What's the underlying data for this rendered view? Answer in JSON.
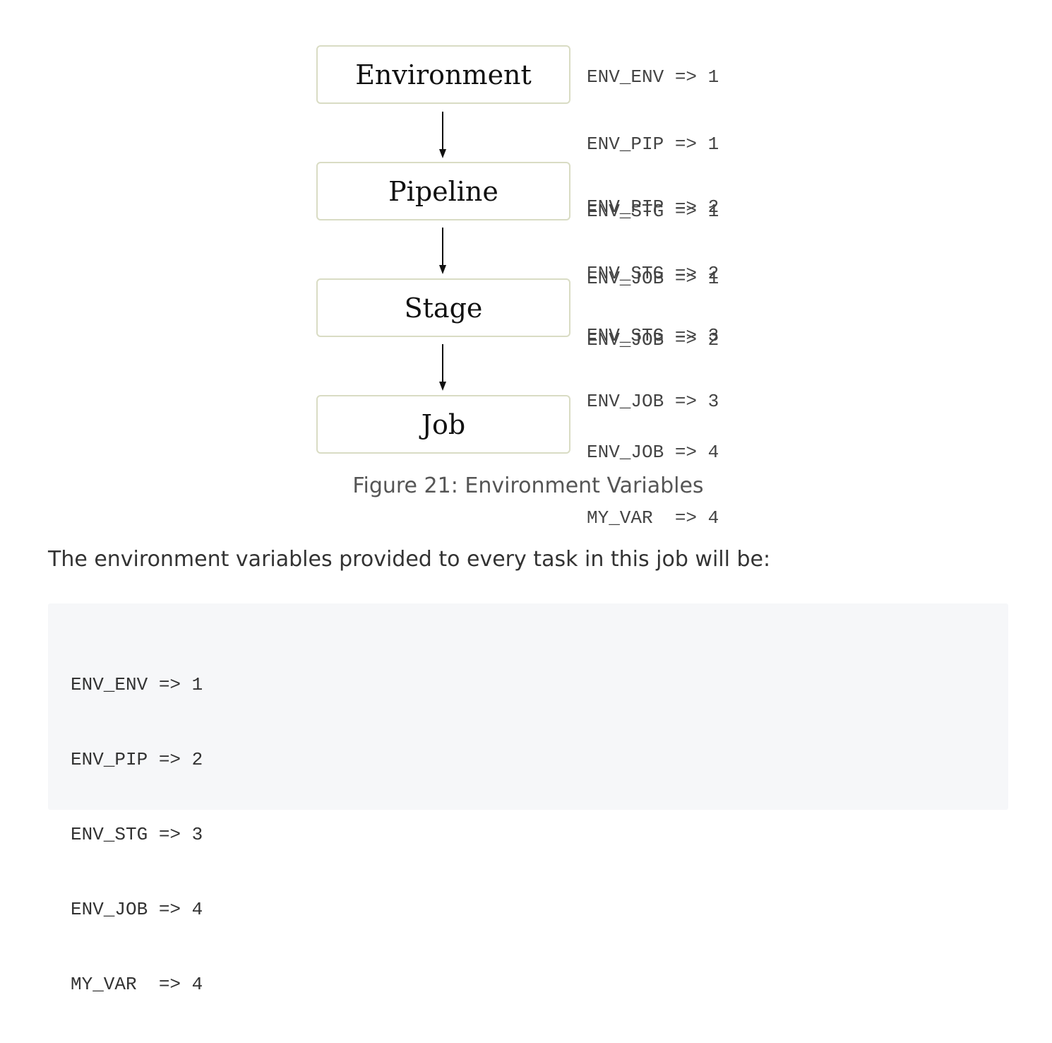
{
  "diagram": {
    "nodes": [
      {
        "label": "Environment",
        "vars": [
          "ENV_ENV => 1",
          "ENV_PIP => 1",
          "ENV_STG => 1",
          "ENV_JOB => 1"
        ]
      },
      {
        "label": "Pipeline",
        "vars": [
          "ENV_PIP => 2",
          "ENV_STG => 2",
          "ENV_JOB => 2"
        ]
      },
      {
        "label": "Stage",
        "vars": [
          "ENV_STG => 3",
          "ENV_JOB => 3"
        ]
      },
      {
        "label": "Job",
        "vars": [
          "ENV_JOB => 4",
          "MY_VAR  => 4"
        ]
      }
    ],
    "caption": "Figure 21: Environment Variables"
  },
  "paragraph": "The environment variables provided to every task in this job will be:",
  "code_lines": [
    "ENV_ENV => 1",
    "ENV_PIP => 2",
    "ENV_STG => 3",
    "ENV_JOB => 4",
    "MY_VAR  => 4"
  ]
}
